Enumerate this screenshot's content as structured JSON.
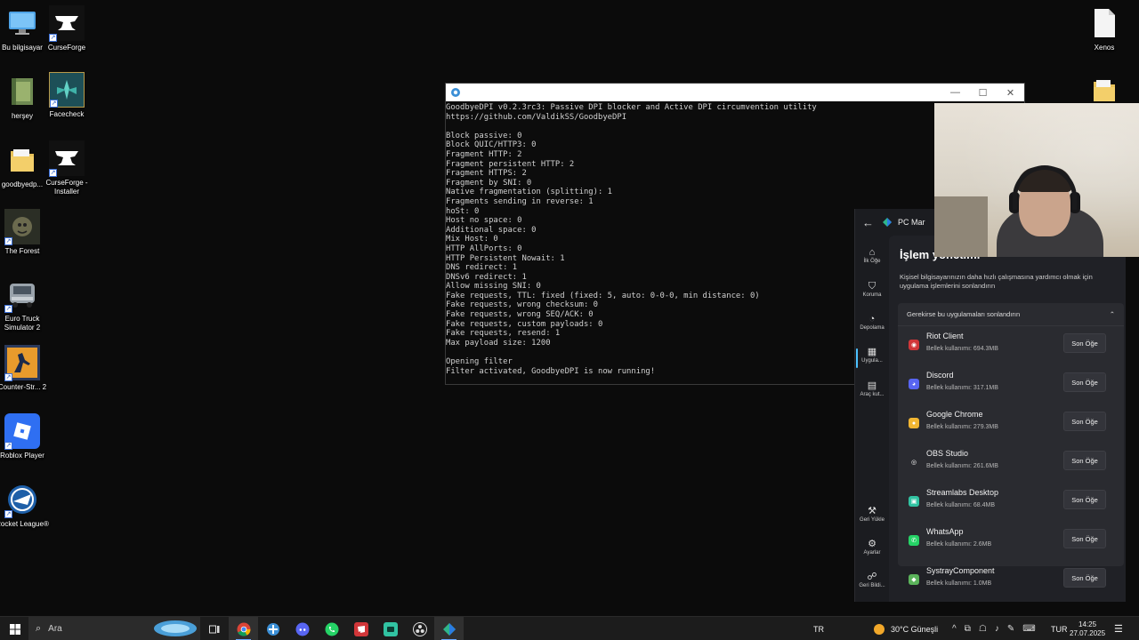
{
  "desktop_icons": [
    {
      "label": "Bu bilgisayar",
      "icon": "pc-icon"
    },
    {
      "label": "CurseForge",
      "icon": "anvil-icon"
    },
    {
      "label": "herşey",
      "icon": "folder-icon"
    },
    {
      "label": "Facecheck",
      "icon": "facecheck-icon"
    },
    {
      "label": "goodbyedp...",
      "icon": "folder-icon"
    },
    {
      "label": "CurseForge - Installer",
      "icon": "anvil-icon"
    },
    {
      "label": "The Forest",
      "icon": "game-icon"
    },
    {
      "label": "Euro Truck Simulator 2",
      "icon": "truck-icon"
    },
    {
      "label": "Counter-Str... 2",
      "icon": "cs2-icon"
    },
    {
      "label": "Roblox Player",
      "icon": "roblox-icon"
    },
    {
      "label": "Rocket League®",
      "icon": "rocket-league-icon"
    },
    {
      "label": "Xenos",
      "icon": "file-icon"
    }
  ],
  "console": {
    "lines": [
      "GoodbyeDPI v0.2.3rc3: Passive DPI blocker and Active DPI circumvention utility",
      "https://github.com/ValdikSS/GoodbyeDPI",
      "",
      "Block passive: 0",
      "Block QUIC/HTTP3: 0",
      "Fragment HTTP: 2",
      "Fragment persistent HTTP: 2",
      "Fragment HTTPS: 2",
      "Fragment by SNI: 0",
      "Native fragmentation (splitting): 1",
      "Fragments sending in reverse: 1",
      "hoSt: 0",
      "Host no space: 0",
      "Additional space: 0",
      "Mix Host: 0",
      "HTTP AllPorts: 0",
      "HTTP Persistent Nowait: 1",
      "DNS redirect: 1",
      "DNSv6 redirect: 1",
      "Allow missing SNI: 0",
      "Fake requests, TTL: fixed (fixed: 5, auto: 0-0-0, min distance: 0)",
      "Fake requests, wrong checksum: 0",
      "Fake requests, wrong SEQ/ACK: 0",
      "Fake requests, custom payloads: 0",
      "Fake requests, resend: 1",
      "Max payload size: 1200",
      "",
      "Opening filter",
      "Filter activated, GoodbyeDPI is now running!"
    ],
    "buttons": {
      "minimize": "—",
      "maximize": "☐",
      "close": "✕"
    }
  },
  "pcmanager": {
    "app_title": "PC Mar",
    "back_glyph": "←",
    "nav": [
      {
        "label": "İlk Öğe",
        "glyph": "⌂"
      },
      {
        "label": "Koruma",
        "glyph": "⛉"
      },
      {
        "label": "Depolama",
        "glyph": "◔"
      },
      {
        "label": "Uygula...",
        "glyph": "▦"
      },
      {
        "label": "Araç kut...",
        "glyph": "▤"
      },
      {
        "label": "Geri Yükle",
        "glyph": "⚒"
      },
      {
        "label": "Ayarlar",
        "glyph": "⚙"
      },
      {
        "label": "Geri Bildi...",
        "glyph": "☍"
      }
    ],
    "page_title": "İşlem yönetimi",
    "page_desc": "Kişisel bilgisayarınızın daha hızlı çalışmasına yardımcı olmak için uygulama işlemlerini sonlandırın",
    "section_title": "Gerekirse bu uygulamaları sonlandırın",
    "section_chevron": "⌃",
    "apps": [
      {
        "name": "Riot Client",
        "mem": "Bellek kullanımı: 694.3MB",
        "btn": "Son Öğe",
        "color": "#d13639",
        "glyph": "◉"
      },
      {
        "name": "Discord",
        "mem": "Bellek kullanımı: 317.1MB",
        "btn": "Son Öğe",
        "color": "#5865f2",
        "glyph": "◕"
      },
      {
        "name": "Google Chrome",
        "mem": "Bellek kullanımı: 279.3MB",
        "btn": "Son Öğe",
        "color": "#f2b632",
        "glyph": "●"
      },
      {
        "name": "OBS Studio",
        "mem": "Bellek kullanımı: 261.6MB",
        "btn": "Son Öğe",
        "color": "#2a2b30",
        "glyph": "◎"
      },
      {
        "name": "Streamlabs Desktop",
        "mem": "Bellek kullanımı: 68.4MB",
        "btn": "Son Öğe",
        "color": "#31c3a2",
        "glyph": "▣"
      },
      {
        "name": "WhatsApp",
        "mem": "Bellek kullanımı: 2.6MB",
        "btn": "Son Öğe",
        "color": "#25d366",
        "glyph": "✆"
      },
      {
        "name": "SystrayComponent",
        "mem": "Bellek kullanımı: 1.0MB",
        "btn": "Son Öğe",
        "color": "#5bb35b",
        "glyph": "◆"
      }
    ]
  },
  "taskbar": {
    "search_placeholder": "Ara",
    "lang_indicator": "TR",
    "weather": "30°C  Güneşli",
    "keyboard_lang": "TUR",
    "time": "14:25",
    "date": "27.07.2025"
  }
}
